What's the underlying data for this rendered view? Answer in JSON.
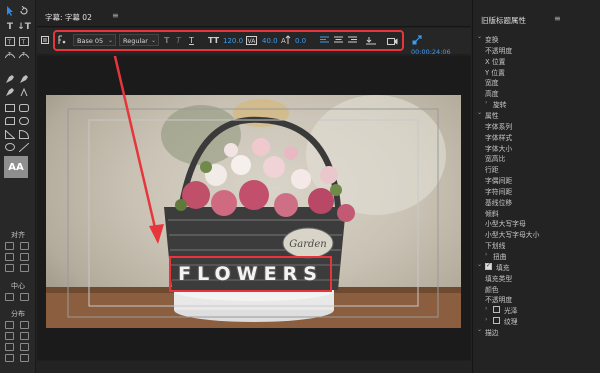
{
  "left_panel": {
    "swatch_label": "AA",
    "align_label": "对齐",
    "center_label": "中心",
    "distribute_label": "分布"
  },
  "editor": {
    "tab_title": "字幕: 字幕 02",
    "tab_menu": "≡",
    "font_family": "Base 05",
    "font_style": "Regular",
    "font_size": "120.0",
    "kerning": "40.0",
    "leading": "0.0",
    "timecode": "00:00:24:06",
    "caption_text": "FLOWERS",
    "sign_text": "Garden"
  },
  "props": {
    "title": "旧版标题属性",
    "menu": "≡",
    "items": [
      {
        "label": "变换",
        "kind": "section"
      },
      {
        "label": "不透明度",
        "kind": "item"
      },
      {
        "label": "X 位置",
        "kind": "item"
      },
      {
        "label": "Y 位置",
        "kind": "item"
      },
      {
        "label": "宽度",
        "kind": "item"
      },
      {
        "label": "高度",
        "kind": "item"
      },
      {
        "label": "旋转",
        "kind": "sub"
      },
      {
        "label": "属性",
        "kind": "section"
      },
      {
        "label": "字体系列",
        "kind": "item"
      },
      {
        "label": "字体样式",
        "kind": "item"
      },
      {
        "label": "字体大小",
        "kind": "item"
      },
      {
        "label": "宽高比",
        "kind": "item"
      },
      {
        "label": "行距",
        "kind": "item"
      },
      {
        "label": "字偶间距",
        "kind": "item"
      },
      {
        "label": "字符间距",
        "kind": "item"
      },
      {
        "label": "基线位移",
        "kind": "item"
      },
      {
        "label": "倾斜",
        "kind": "item"
      },
      {
        "label": "小型大写字母",
        "kind": "item"
      },
      {
        "label": "小型大写字母大小",
        "kind": "item"
      },
      {
        "label": "下划线",
        "kind": "item"
      },
      {
        "label": "扭曲",
        "kind": "sub"
      },
      {
        "label": "填充",
        "kind": "checkbox-section"
      },
      {
        "label": "填充类型",
        "kind": "item"
      },
      {
        "label": "颜色",
        "kind": "item"
      },
      {
        "label": "不透明度",
        "kind": "item"
      },
      {
        "label": "光泽",
        "kind": "sub-checkbox"
      },
      {
        "label": "纹理",
        "kind": "sub-checkbox"
      },
      {
        "label": "描边",
        "kind": "section"
      }
    ]
  },
  "colors": {
    "accent_blue": "#3b9cf0",
    "annotation_red": "#e8353c"
  },
  "icons": [
    "selection-icon",
    "rotate-icon",
    "type-icon",
    "vertical-type-icon",
    "area-type-icon",
    "path-type-icon",
    "pen-icon",
    "add-anchor-icon",
    "delete-anchor-icon",
    "convert-anchor-icon",
    "rectangle-icon",
    "rounded-rectangle-icon",
    "ellipse-icon",
    "line-icon",
    "wedge-icon",
    "arc-icon"
  ]
}
